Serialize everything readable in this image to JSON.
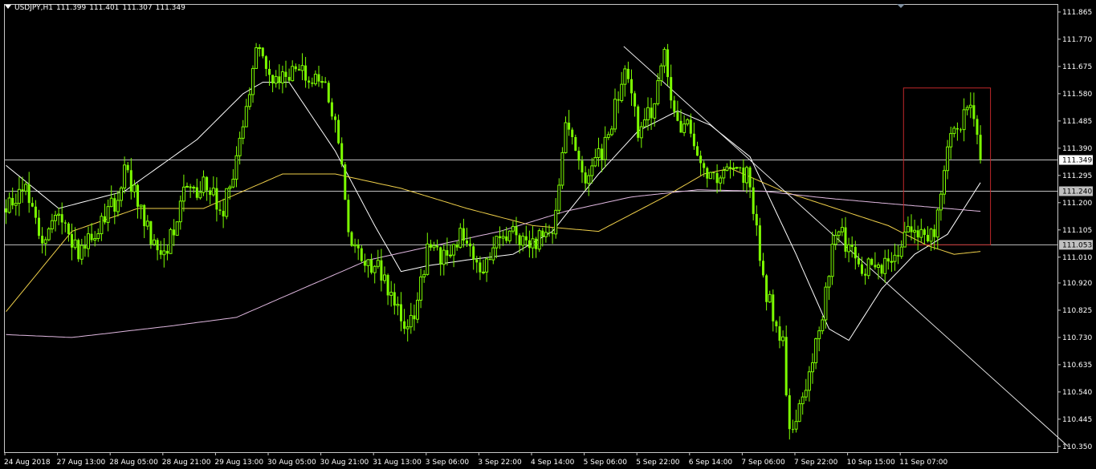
{
  "header": {
    "symbol": "USDJPY,H1",
    "open": "111.399",
    "high": "111.401",
    "low": "111.307",
    "close": "111.349"
  },
  "chart_data": {
    "type": "candlestick",
    "symbol": "USDJPY",
    "timeframe": "H1",
    "y_axis": {
      "ticks": [
        "111.865",
        "111.770",
        "111.675",
        "111.580",
        "111.485",
        "111.390",
        "111.295",
        "111.200",
        "111.105",
        "111.010",
        "110.920",
        "110.825",
        "110.730",
        "110.635",
        "110.540",
        "110.445",
        "110.350"
      ],
      "ylim": [
        110.33,
        111.89
      ]
    },
    "x_axis": {
      "labels": [
        "24 Aug 2018",
        "27 Aug 13:00",
        "28 Aug 05:00",
        "28 Aug 21:00",
        "29 Aug 13:00",
        "30 Aug 05:00",
        "30 Aug 21:00",
        "31 Aug 13:00",
        "3 Sep 06:00",
        "3 Sep 22:00",
        "4 Sep 14:00",
        "5 Sep 06:00",
        "5 Sep 22:00",
        "6 Sep 14:00",
        "7 Sep 06:00",
        "7 Sep 22:00",
        "10 Sep 15:00",
        "11 Sep 07:00"
      ],
      "bars_per_label": 16
    },
    "price_levels": [
      {
        "label": "111.349",
        "value": 111.349,
        "highlight": true
      },
      {
        "label": "111.240",
        "value": 111.24,
        "highlight": false
      },
      {
        "label": "111.053",
        "value": 111.053,
        "highlight": false
      }
    ],
    "close_anchors": [
      [
        0,
        111.18
      ],
      [
        6,
        111.28
      ],
      [
        11,
        111.05
      ],
      [
        16,
        111.17
      ],
      [
        22,
        111.02
      ],
      [
        28,
        111.12
      ],
      [
        34,
        111.22
      ],
      [
        36,
        111.34
      ],
      [
        42,
        111.12
      ],
      [
        48,
        111.02
      ],
      [
        54,
        111.22
      ],
      [
        60,
        111.26
      ],
      [
        66,
        111.18
      ],
      [
        72,
        111.45
      ],
      [
        76,
        111.74
      ],
      [
        80,
        111.62
      ],
      [
        88,
        111.65
      ],
      [
        96,
        111.63
      ],
      [
        100,
        111.5
      ],
      [
        104,
        111.1
      ],
      [
        110,
        110.98
      ],
      [
        114,
        110.96
      ],
      [
        120,
        110.8
      ],
      [
        124,
        110.78
      ],
      [
        128,
        111.05
      ],
      [
        134,
        111.0
      ],
      [
        138,
        111.1
      ],
      [
        144,
        110.94
      ],
      [
        148,
        111.05
      ],
      [
        154,
        111.1
      ],
      [
        160,
        111.06
      ],
      [
        166,
        111.11
      ],
      [
        170,
        111.46
      ],
      [
        176,
        111.28
      ],
      [
        182,
        111.4
      ],
      [
        188,
        111.66
      ],
      [
        192,
        111.45
      ],
      [
        196,
        111.52
      ],
      [
        200,
        111.7
      ],
      [
        204,
        111.48
      ],
      [
        208,
        111.45
      ],
      [
        214,
        111.28
      ],
      [
        220,
        111.33
      ],
      [
        226,
        111.28
      ],
      [
        230,
        110.92
      ],
      [
        236,
        110.7
      ],
      [
        238,
        110.42
      ],
      [
        242,
        110.52
      ],
      [
        248,
        110.8
      ],
      [
        252,
        111.12
      ],
      [
        258,
        111.0
      ],
      [
        264,
        110.96
      ],
      [
        270,
        111.02
      ],
      [
        276,
        111.12
      ],
      [
        282,
        111.07
      ],
      [
        286,
        111.42
      ],
      [
        290,
        111.48
      ],
      [
        293,
        111.53
      ],
      [
        296,
        111.349
      ]
    ],
    "moving_averages": [
      {
        "color": "#ffffff",
        "anchors": [
          [
            0,
            111.33
          ],
          [
            16,
            111.18
          ],
          [
            36,
            111.24
          ],
          [
            58,
            111.42
          ],
          [
            72,
            111.58
          ],
          [
            78,
            111.62
          ],
          [
            86,
            111.62
          ],
          [
            100,
            111.38
          ],
          [
            112,
            111.12
          ],
          [
            120,
            110.96
          ],
          [
            128,
            110.98
          ],
          [
            140,
            111.0
          ],
          [
            154,
            111.02
          ],
          [
            166,
            111.1
          ],
          [
            180,
            111.3
          ],
          [
            192,
            111.45
          ],
          [
            204,
            111.52
          ],
          [
            214,
            111.47
          ],
          [
            226,
            111.36
          ],
          [
            240,
            111.02
          ],
          [
            250,
            110.76
          ],
          [
            256,
            110.72
          ],
          [
            266,
            110.9
          ],
          [
            276,
            111.02
          ],
          [
            286,
            111.09
          ],
          [
            296,
            111.27
          ]
        ]
      },
      {
        "color": "#f0d04a",
        "anchors": [
          [
            0,
            110.82
          ],
          [
            20,
            111.1
          ],
          [
            40,
            111.18
          ],
          [
            60,
            111.18
          ],
          [
            72,
            111.24
          ],
          [
            84,
            111.3
          ],
          [
            100,
            111.3
          ],
          [
            120,
            111.25
          ],
          [
            140,
            111.18
          ],
          [
            160,
            111.12
          ],
          [
            180,
            111.1
          ],
          [
            200,
            111.22
          ],
          [
            212,
            111.3
          ],
          [
            220,
            111.32
          ],
          [
            236,
            111.24
          ],
          [
            252,
            111.18
          ],
          [
            268,
            111.12
          ],
          [
            280,
            111.05
          ],
          [
            288,
            111.02
          ],
          [
            296,
            111.03
          ]
        ]
      },
      {
        "color": "#e0b8e0",
        "anchors": [
          [
            0,
            110.74
          ],
          [
            20,
            110.73
          ],
          [
            50,
            110.77
          ],
          [
            70,
            110.8
          ],
          [
            90,
            110.9
          ],
          [
            110,
            111.0
          ],
          [
            130,
            111.05
          ],
          [
            150,
            111.1
          ],
          [
            170,
            111.17
          ],
          [
            190,
            111.22
          ],
          [
            210,
            111.245
          ],
          [
            230,
            111.24
          ],
          [
            250,
            111.215
          ],
          [
            270,
            111.195
          ],
          [
            296,
            111.17
          ]
        ]
      }
    ],
    "trendline": {
      "start": [
        188,
        111.745
      ],
      "end": [
        323,
        110.35
      ]
    },
    "highlight_box": {
      "from_bar": 273,
      "to_bar": 296,
      "top": 111.6,
      "bottom": 111.053
    }
  }
}
